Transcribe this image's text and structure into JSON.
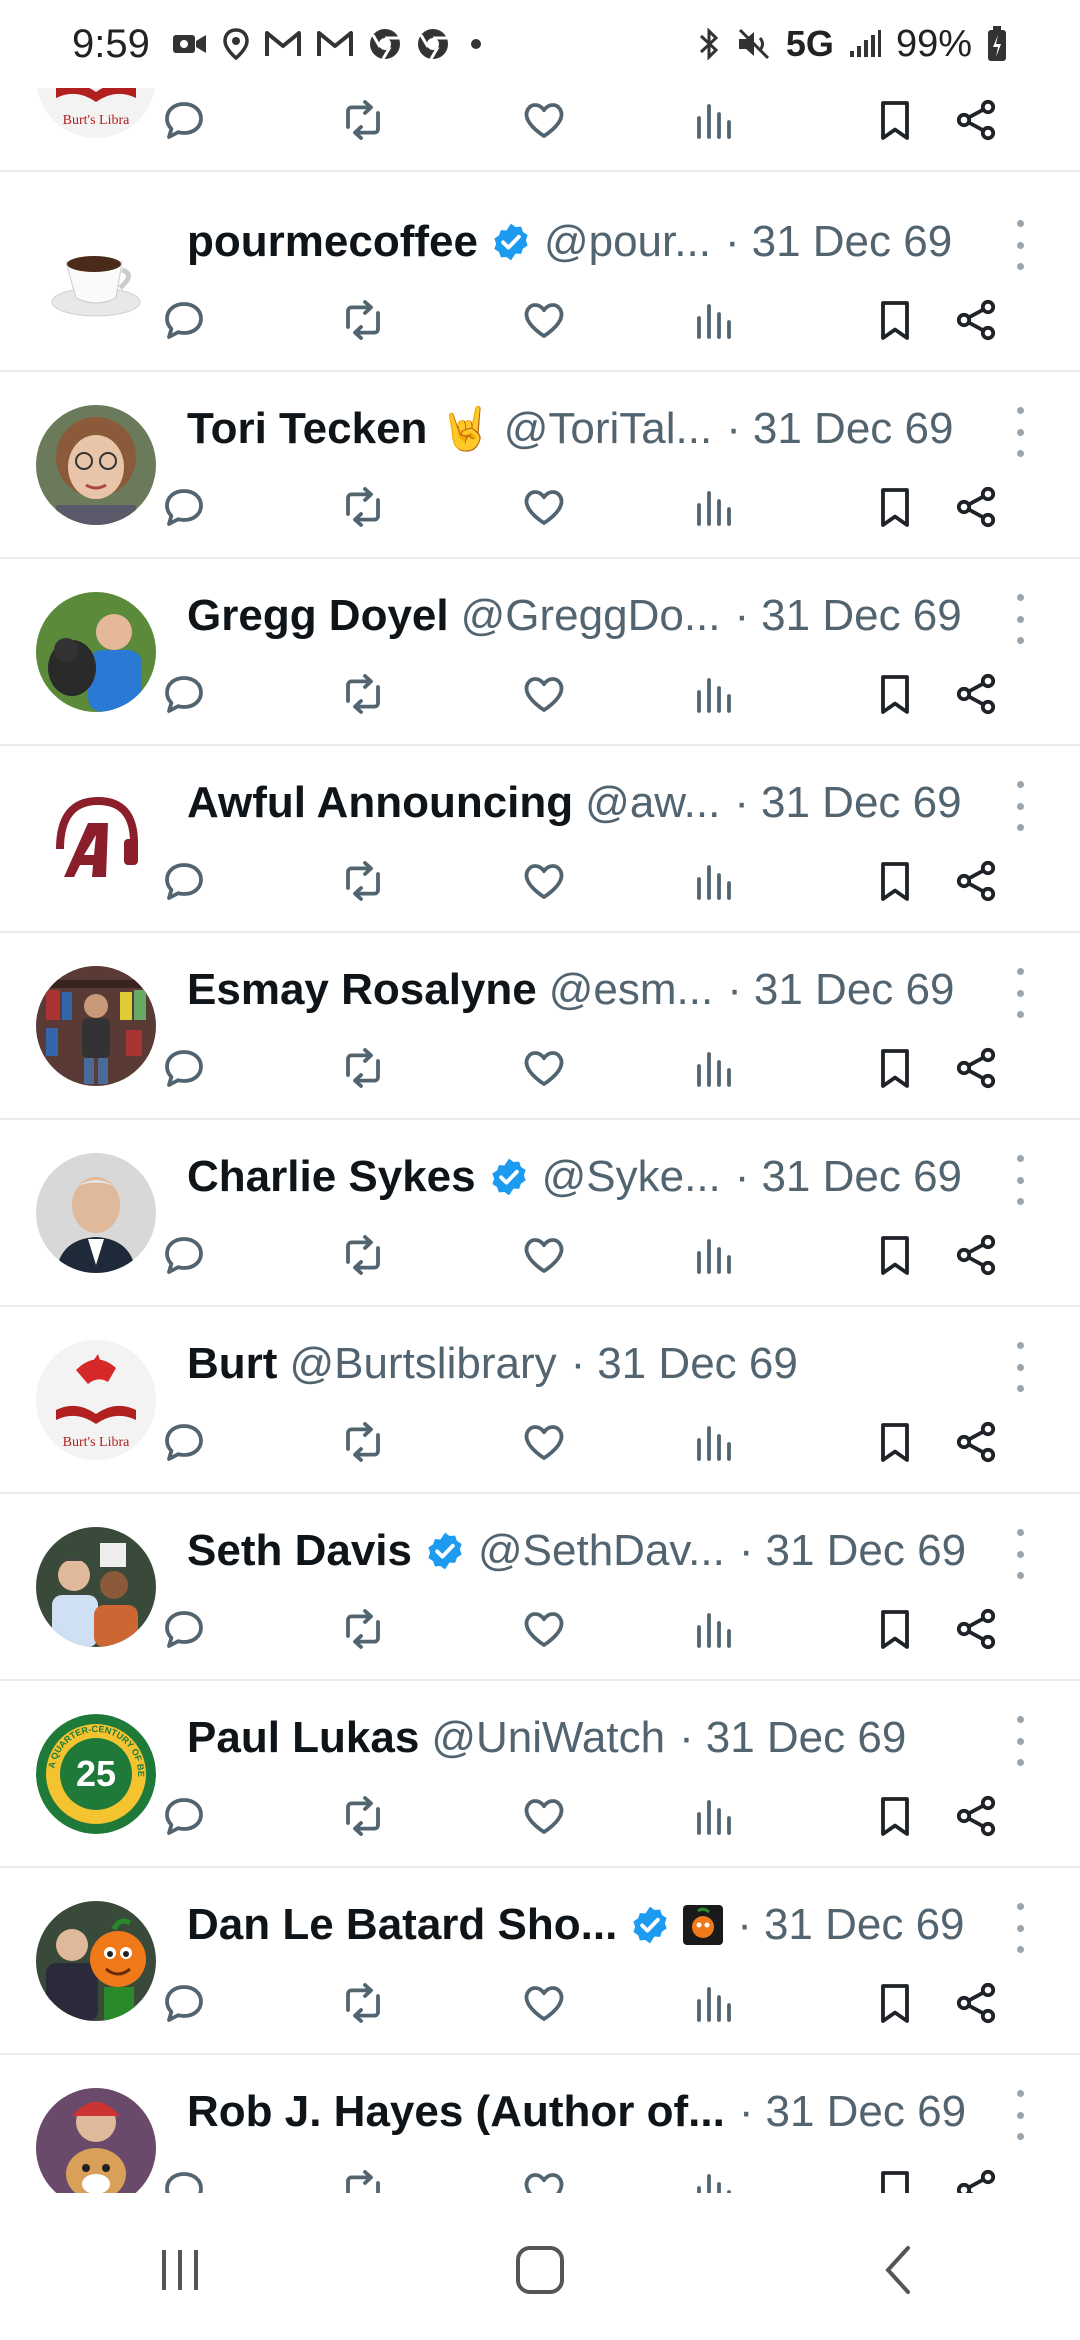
{
  "status_bar": {
    "time": "9:59",
    "left_icons": [
      "video-icon",
      "location-icon",
      "gmail-icon",
      "gmail-icon",
      "chrome-icon",
      "chrome-icon",
      "dot-icon"
    ],
    "network": "5G",
    "battery": "99%"
  },
  "posts": [
    {
      "name": "",
      "handle": "",
      "date": "",
      "verified": false,
      "avatar": "burt"
    },
    {
      "name": "pourmecoffee",
      "handle": "@pour...",
      "date": "31 Dec 69",
      "verified": true,
      "avatar": "coffee"
    },
    {
      "name": "Tori Tecken",
      "handle": "@ToriTal...",
      "date": "31 Dec 69",
      "verified": false,
      "emoji": "🤘",
      "avatar": "tori"
    },
    {
      "name": "Gregg Doyel",
      "handle": "@GreggDo...",
      "date": "31 Dec 69",
      "verified": false,
      "avatar": "gregg"
    },
    {
      "name": "Awful Announcing",
      "handle": "@aw...",
      "date": "31 Dec 69",
      "verified": false,
      "avatar": "awful"
    },
    {
      "name": "Esmay Rosalyne",
      "handle": "@esm...",
      "date": "31 Dec 69",
      "verified": false,
      "avatar": "esmay"
    },
    {
      "name": "Charlie Sykes",
      "handle": "@Syke...",
      "date": "31 Dec 69",
      "verified": true,
      "avatar": "charlie"
    },
    {
      "name": "Burt",
      "handle": "@Burtslibrary",
      "date": "31 Dec 69",
      "verified": false,
      "avatar": "burt"
    },
    {
      "name": "Seth Davis",
      "handle": "@SethDav...",
      "date": "31 Dec 69",
      "verified": true,
      "avatar": "seth"
    },
    {
      "name": "Paul Lukas",
      "handle": "@UniWatch",
      "date": "31 Dec 69",
      "verified": false,
      "avatar": "paul"
    },
    {
      "name": "Dan Le Batard Sho...",
      "handle": "",
      "date": "31 Dec 69",
      "verified": true,
      "emoji_badge": true,
      "avatar": "dan"
    },
    {
      "name": "Rob J. Hayes (Author of...",
      "handle": "",
      "date": "31 Dec 69",
      "verified": false,
      "avatar": "rob"
    }
  ],
  "avatar_text": {
    "burt": "Burt's Libra",
    "paul_number": "25",
    "paul_ring": "A QUARTER-CENTURY OF BEING"
  },
  "action_icons": [
    "reply-icon",
    "retweet-icon",
    "like-icon",
    "views-icon",
    "bookmark-icon",
    "share-icon"
  ],
  "nav_bar": [
    "recents-icon",
    "home-icon",
    "back-icon"
  ],
  "colors": {
    "verified": "#1d9bf0",
    "icon_gray": "#536471",
    "divider": "#e6ecf0"
  }
}
